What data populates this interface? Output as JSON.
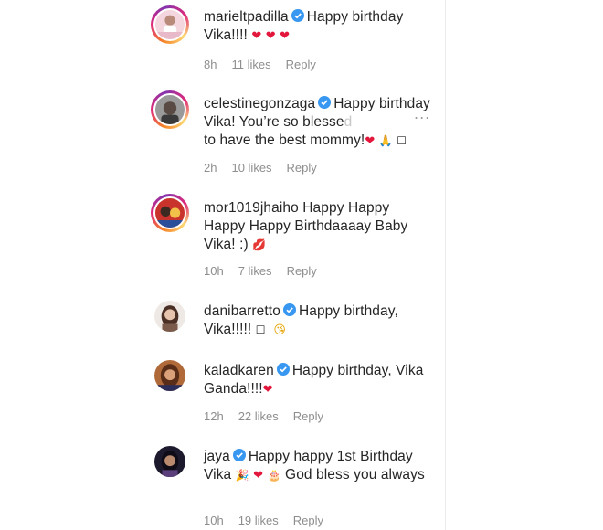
{
  "comments": [
    {
      "username": "marieltpadilla",
      "text_before": "Happy birthday Vika!!!! ",
      "emojis": [
        "❤",
        "❤",
        "❤"
      ],
      "time": "8h",
      "likes": "11 likes",
      "reply": "Reply"
    },
    {
      "username": "celestinegonzaga",
      "text_before": "Happy birthday Vika! You’re so blesse",
      "text_fade": "d",
      "text_line2": "to have the best mommy!",
      "emojis": [
        "❤",
        "🙏",
        "☐"
      ],
      "time": "2h",
      "likes": "10 likes",
      "reply": "Reply"
    },
    {
      "username": "mor1019jhaiho",
      "text_before": "Happy Happy Happy Happy Birthdaaaay Baby Vika! :) ",
      "emojis": [
        "💋"
      ],
      "time": "10h",
      "likes": "7 likes",
      "reply": "Reply"
    },
    {
      "username": "danibarretto",
      "text_before": "Happy birthday, Vika!!!!! ",
      "emojis": [
        "☐",
        "😘"
      ],
      "time": "",
      "likes": "",
      "reply": ""
    },
    {
      "username": "kaladkaren",
      "text_before": "Happy birthday, Vika Ganda!!!!",
      "emojis": [
        "❤"
      ],
      "time": "12h",
      "likes": "22 likes",
      "reply": "Reply"
    },
    {
      "username": "jaya",
      "text_before": "Happy happy 1st Birthday Vika ",
      "emojis": [
        "🎉",
        "❤",
        "🎂"
      ],
      "text_after": " God bless you always",
      "time": "10h",
      "likes": "19 likes",
      "reply": "Reply"
    }
  ],
  "more_options": "...",
  "colors": {
    "verified": "#3897f0",
    "heart": "#e3163c",
    "meta": "#8e8e8e"
  },
  "icons": [
    "verified-badge-icon",
    "more-options-icon",
    "heart-emoji",
    "pray-emoji",
    "kiss-emoji",
    "party-emoji",
    "cake-emoji",
    "kissing-face-emoji"
  ]
}
